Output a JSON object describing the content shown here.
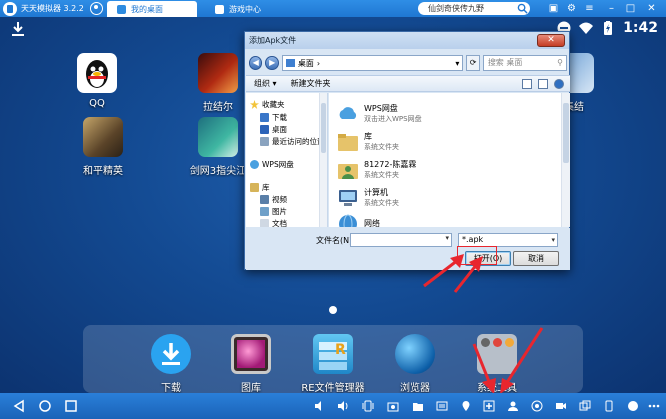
{
  "emulator": {
    "title": "天天模拟器 3.2.2",
    "tabs": [
      {
        "label": "我的桌面",
        "active": true
      },
      {
        "label": "游戏中心",
        "active": false
      }
    ],
    "search_value": "仙剑奇侠传九野",
    "accent": "#1f77d2"
  },
  "status_bar": {
    "time": "1:42"
  },
  "desktop_apps": [
    {
      "label": "QQ",
      "icon": "qq-penguin-icon"
    },
    {
      "label": "拉结尔",
      "icon": "game-lajieer-icon"
    },
    {
      "label": "集结",
      "icon": "game-jijie-icon"
    },
    {
      "label": "和平精英",
      "icon": "game-heping-icon"
    },
    {
      "label": "剑网3指尖江",
      "icon": "game-jianwang-icon"
    }
  ],
  "dock": [
    {
      "label": "下载",
      "icon": "download-icon"
    },
    {
      "label": "图库",
      "icon": "gallery-icon"
    },
    {
      "label": "RE文件管理器",
      "icon": "re-file-manager-icon"
    },
    {
      "label": "浏览器",
      "icon": "browser-globe-icon"
    },
    {
      "label": "系统工具",
      "icon": "system-tools-icon"
    }
  ],
  "dialog": {
    "title": "添加Apk文件",
    "address": "桌面",
    "search_placeholder": "搜索 桌面",
    "toolbar": {
      "organize": "组织 ▾",
      "new_folder": "新建文件夹"
    },
    "nav": {
      "favorites": "收藏夹",
      "favorites_items": [
        "下载",
        "桌面",
        "最近访问的位置"
      ],
      "wps": "WPS网盘",
      "libraries": "库",
      "library_items": [
        "视频",
        "图片",
        "文档"
      ]
    },
    "files": [
      {
        "name": "WPS网盘",
        "sub": "双击进入WPS网盘"
      },
      {
        "name": "库",
        "sub": "系统文件夹"
      },
      {
        "name": "81272-陈嘉霖",
        "sub": "系统文件夹"
      },
      {
        "name": "计算机",
        "sub": "系统文件夹"
      },
      {
        "name": "网络",
        "sub": ""
      }
    ],
    "filename_label": "文件名(N):",
    "filename_value": "",
    "filetype": "*.apk",
    "open_label": "打开(O)",
    "cancel_label": "取消"
  }
}
